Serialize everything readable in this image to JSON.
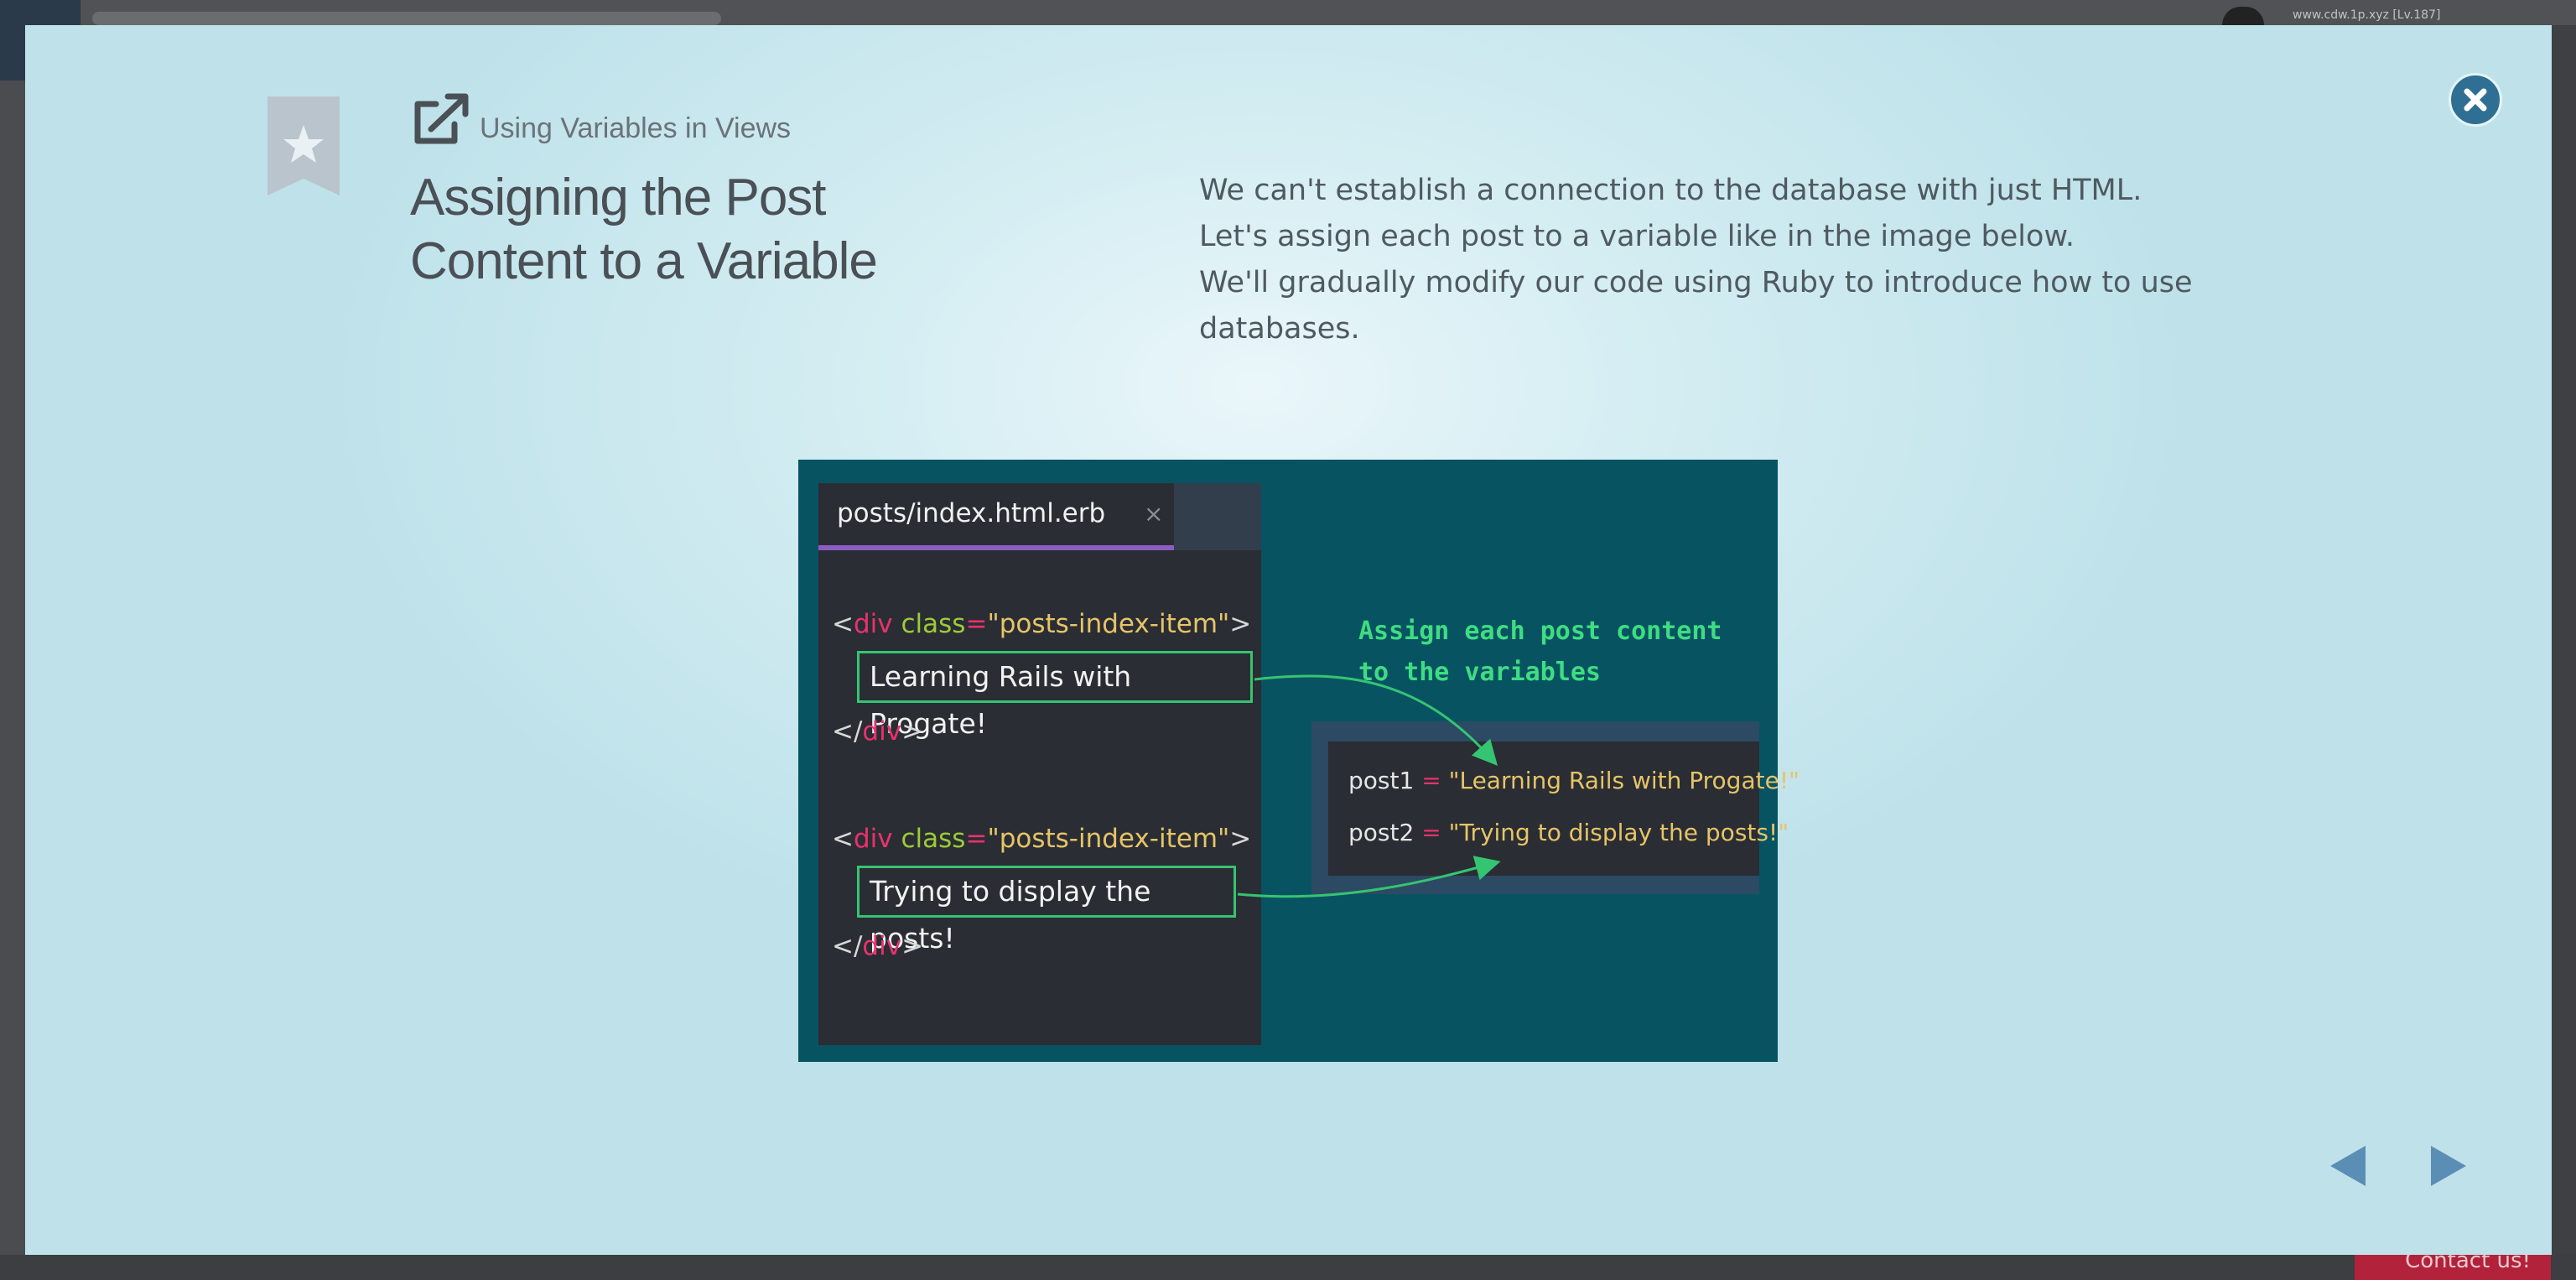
{
  "background": {
    "user_text": "www.cdw.1p.xyz [Lv.187]",
    "contact_label": "Contact us!"
  },
  "modal": {
    "subtitle": "Using Variables in Views",
    "title_line1": "Assigning the Post",
    "title_line2": "Content to a Variable",
    "description": [
      "We can't establish a connection to the database with just HTML.",
      "Let's assign each post to a variable like in the image below.",
      "We'll gradually modify our code using Ruby to introduce how to use",
      "databases."
    ],
    "icons": {
      "bookmark": "bookmark-star-icon",
      "header": "external-link-icon",
      "close": "close-icon",
      "prev": "triangle-left-icon",
      "next": "triangle-right-icon"
    },
    "colors": {
      "accent": "#2f6f93",
      "figure_bg": "#075362",
      "highlight": "#35c472"
    }
  },
  "figure": {
    "tab_label": "posts/index.html.erb",
    "tab_close": "×",
    "code": {
      "lt": "<",
      "gt": ">",
      "close_open": "</",
      "tag": "div",
      "attr": "class",
      "eq": "=",
      "value": "\"posts-index-item\"",
      "post1_text": "Learning Rails with Progate!",
      "post2_text": "Trying to display the posts!"
    },
    "annotation_line1": "Assign each post content",
    "annotation_line2": "to the variables",
    "vars": {
      "post1_name": "post1",
      "post2_name": "post2",
      "op": "=",
      "post1_value": "\"Learning Rails with Progate!\"",
      "post2_value": "\"Trying to display the posts!\""
    }
  }
}
